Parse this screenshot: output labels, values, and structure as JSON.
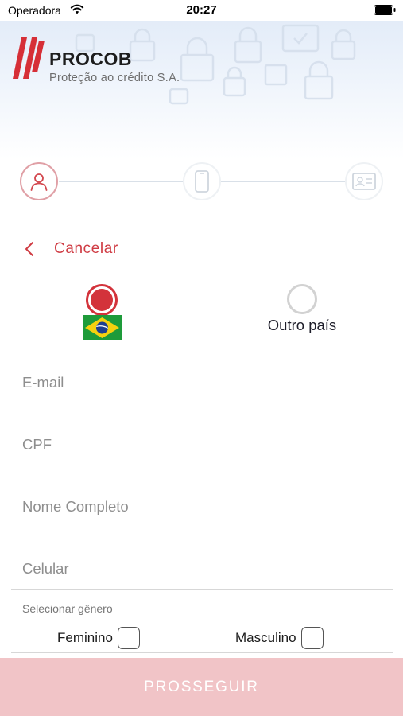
{
  "status_bar": {
    "carrier": "Operadora",
    "time": "20:27"
  },
  "brand": {
    "name": "PROCOB",
    "tagline": "Proteção ao crédito S.A.",
    "accent_color": "#cf3b43"
  },
  "stepper": {
    "steps": [
      {
        "icon": "user-icon",
        "state": "active"
      },
      {
        "icon": "smartphone-icon",
        "state": "inactive"
      },
      {
        "icon": "id-card-icon",
        "state": "inactive"
      }
    ]
  },
  "nav": {
    "cancel_label": "Cancelar",
    "back_icon": "chevron-left-icon"
  },
  "nationality": {
    "brazil": {
      "selected": true,
      "icon": "brazil-flag-icon"
    },
    "other": {
      "selected": false,
      "label": "Outro país"
    }
  },
  "form": {
    "email_placeholder": "E-mail",
    "cpf_placeholder": "CPF",
    "name_placeholder": "Nome Completo",
    "phone_placeholder": "Celular",
    "email_value": "",
    "cpf_value": "",
    "name_value": "",
    "phone_value": ""
  },
  "gender": {
    "label": "Selecionar gênero",
    "options": [
      {
        "label": "Feminino",
        "checked": false
      },
      {
        "label": "Masculino",
        "checked": false
      }
    ]
  },
  "submit": {
    "label": "PROSSEGUIR",
    "enabled": false,
    "color": "#f1c4c7"
  }
}
